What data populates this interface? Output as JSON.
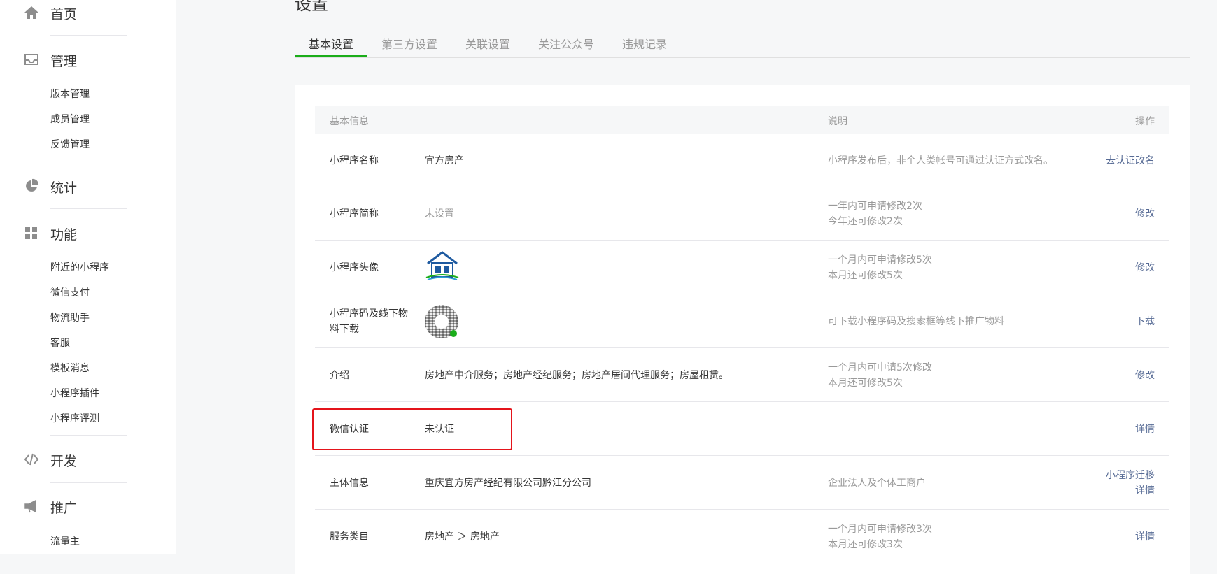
{
  "sidebar": {
    "home": "首页",
    "manage": "管理",
    "manage_items": [
      "版本管理",
      "成员管理",
      "反馈管理"
    ],
    "stats": "统计",
    "features": "功能",
    "feature_items": [
      "附近的小程序",
      "微信支付",
      "物流助手",
      "客服",
      "模板消息",
      "小程序插件",
      "小程序评测"
    ],
    "develop": "开发",
    "promote": "推广",
    "promote_items": [
      "流量主"
    ]
  },
  "page": {
    "title": "设置",
    "tabs": [
      "基本设置",
      "第三方设置",
      "关联设置",
      "关注公众号",
      "违规记录"
    ]
  },
  "table": {
    "headers": {
      "info": "基本信息",
      "desc": "说明",
      "op": "操作"
    },
    "rows": [
      {
        "label": "小程序名称",
        "value": "宜方房产",
        "desc": "小程序发布后，非个人类帐号可通过认证方式改名。",
        "op": "去认证改名"
      },
      {
        "label": "小程序简称",
        "value": "未设置",
        "desc1": "一年内可申请修改2次",
        "desc2": "今年还可修改2次",
        "op": "修改"
      },
      {
        "label": "小程序头像",
        "desc1": "一个月内可申请修改5次",
        "desc2": "本月还可修改5次",
        "op": "修改"
      },
      {
        "label1": "小程序码及线下物",
        "label2": "料下载",
        "desc": "可下载小程序码及搜索框等线下推广物料",
        "op": "下载"
      },
      {
        "label": "介绍",
        "value": "房地产中介服务；房地产经纪服务；房地产居间代理服务；房屋租赁。",
        "desc1": "一个月内可申请5次修改",
        "desc2": "本月还可修改5次",
        "op": "修改"
      },
      {
        "label": "微信认证",
        "value": "未认证",
        "op": "详情"
      },
      {
        "label": "主体信息",
        "value": "重庆宜方房产经纪有限公司黔江分公司",
        "desc": "企业法人及个体工商户",
        "op1": "小程序迁移",
        "op2": "详情"
      },
      {
        "label": "服务类目",
        "value": "房地产 ＞ 房地产",
        "desc1": "一个月内可申请修改3次",
        "desc2": "本月还可修改3次",
        "op": "详情"
      }
    ]
  },
  "colors": {
    "accent": "#1aad19",
    "link": "#576b95",
    "highlight": "#e4141b"
  }
}
